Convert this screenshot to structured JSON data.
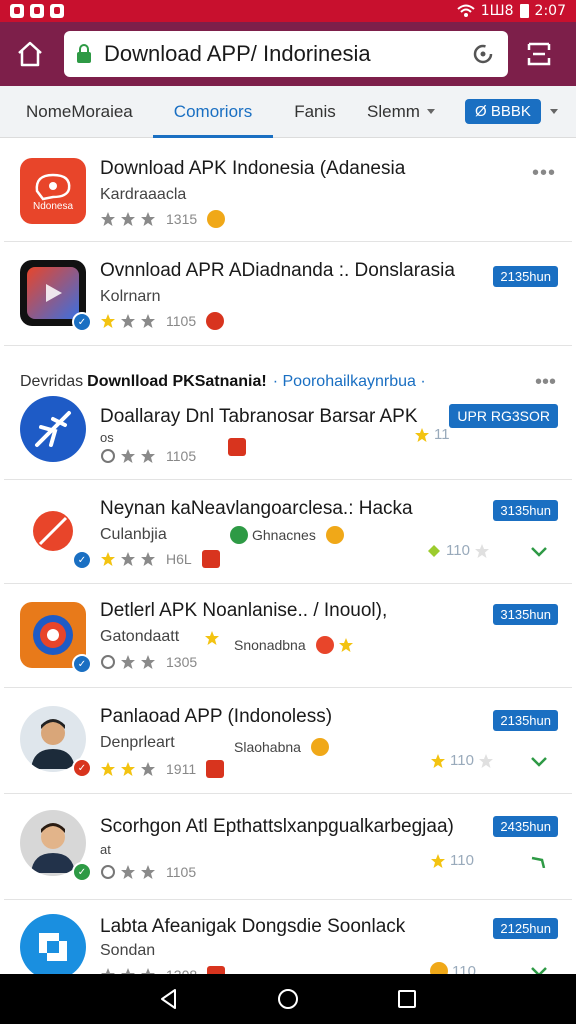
{
  "status_bar": {
    "time": "2:07",
    "signal_text": "1Ш8"
  },
  "browser": {
    "url_title": "Download APP/ Indorinesia"
  },
  "tabs": [
    {
      "label": "NomeMoraiea"
    },
    {
      "label": "Comoriors"
    },
    {
      "label": "Fanis"
    },
    {
      "label": "Slemm"
    }
  ],
  "filter": {
    "label": "Ø BBBK"
  },
  "section": {
    "label_prefix": "Devridas",
    "label_main": "Downlload PKSatnania!",
    "label_link": "· Poorohailkaynrbua ·"
  },
  "apps": [
    {
      "title": "Download APK Indonesia (Adanesia",
      "sub": "Kardraaacla",
      "rating_text": "1315",
      "icon_label": "Ndonesa"
    },
    {
      "title": "Ovnnload APR ADiadnanda :. Donslarasia",
      "sub": "Kolrnarn",
      "rating_text": "1105",
      "tag": "2135hun"
    },
    {
      "title": "Doallaray Dnl Tabranosar Barsar APK",
      "sub": "os",
      "rating_text": "1105",
      "side_value": "11",
      "tag": "UPR RG3SOR"
    },
    {
      "title": "Neynan kaNeavlangoarclesa.: Hacka",
      "sub": "Culanbjia",
      "extra": "Ghnacnes",
      "rating_text": "H6L",
      "side_value": "110",
      "tag": "3135hun"
    },
    {
      "title": "Detlerl APK Noanlanise.. / Inouol),",
      "sub": "Gatondaatt",
      "extra": "Snonadbna",
      "rating_text": "1305",
      "tag": "3135hun"
    },
    {
      "title": "Panlaoad APP (Indonoless)",
      "sub": "Denprleart",
      "extra": "Slaohabna",
      "rating_text": "1911",
      "side_value": "110",
      "tag": "2135hun"
    },
    {
      "title": "Scorhgon Atl Epthattslxanpgualkarbegjaa)",
      "sub": "at",
      "rating_text": "1105",
      "side_value": "110",
      "tag": "2435hun"
    },
    {
      "title": "Labta Afeanigak Dongsdie Soonlack",
      "sub": "Sondan",
      "rating_text": "1308",
      "side_value": "110",
      "tag": "2125hun"
    }
  ],
  "more_label": "•••",
  "colors": {
    "accent": "#1a6fc2",
    "browser_bar": "#7d1f4a",
    "status_bar": "#c8102e",
    "star": "#f3c311"
  }
}
